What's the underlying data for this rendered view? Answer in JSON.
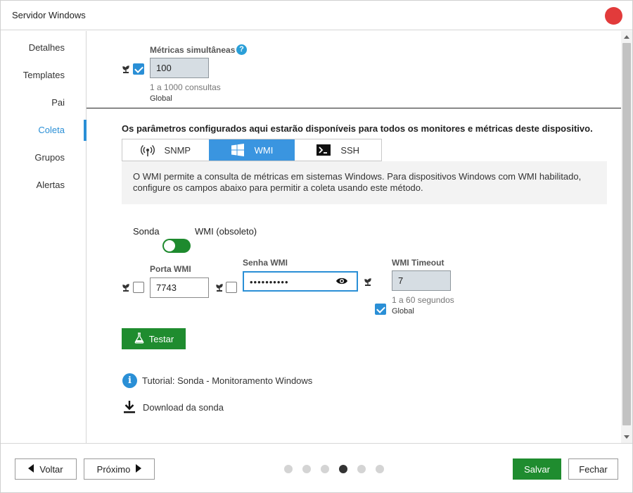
{
  "window": {
    "title": "Servidor Windows"
  },
  "sidebar": {
    "items": [
      {
        "label": "Detalhes"
      },
      {
        "label": "Templates"
      },
      {
        "label": "Pai"
      },
      {
        "label": "Coleta",
        "active": true
      },
      {
        "label": "Grupos"
      },
      {
        "label": "Alertas"
      }
    ]
  },
  "metrics": {
    "label": "Métricas simultâneas",
    "value": "100",
    "hint": "1 a 1000 consultas",
    "scope": "Global",
    "inherited": true
  },
  "collection": {
    "description": "Os parâmetros configurados aqui estarão disponíveis para todos os monitores e métricas deste dispositivo.",
    "tabs": [
      {
        "label": "SNMP",
        "icon": "antenna-icon"
      },
      {
        "label": "WMI",
        "icon": "windows-icon",
        "active": true
      },
      {
        "label": "SSH",
        "icon": "terminal-icon"
      }
    ],
    "info": "O WMI permite a consulta de métricas em sistemas Windows. Para dispositivos Windows com WMI habilitado, configure os campos abaixo para permitir a coleta usando este método.",
    "toggle": {
      "left_label": "Sonda",
      "right_label": "WMI (obsoleto)"
    },
    "port": {
      "label": "Porta WMI",
      "value": "7743",
      "inherited": false
    },
    "password": {
      "label": "Senha WMI",
      "value": "••••••••••",
      "inherited": false
    },
    "timeout": {
      "label": "WMI Timeout",
      "value": "7",
      "hint": "1 a 60 segundos",
      "scope": "Global",
      "inherited": true
    },
    "test_button": "Testar",
    "tutorial_link": "Tutorial: Sonda - Monitoramento Windows",
    "download_link": "Download da sonda"
  },
  "footer": {
    "back": "Voltar",
    "next": "Próximo",
    "steps_total": 6,
    "step_current": 4,
    "save": "Salvar",
    "close": "Fechar"
  },
  "colors": {
    "accent": "#2a8fd6",
    "primary_green": "#1f8c2f",
    "close_red": "#e23b3b"
  }
}
